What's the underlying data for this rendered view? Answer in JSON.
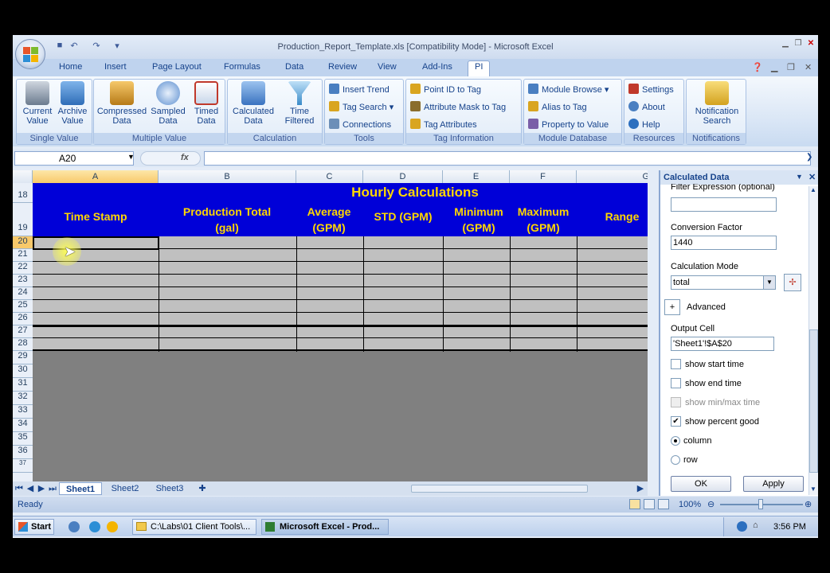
{
  "window": {
    "title": "Production_Report_Template.xls  [Compatibility Mode] - Microsoft Excel"
  },
  "ribbon_tabs": [
    "Home",
    "Insert",
    "Page Layout",
    "Formulas",
    "Data",
    "Review",
    "View",
    "Add-Ins",
    "PI"
  ],
  "active_tab": "PI",
  "groups": {
    "single_value": {
      "label": "Single Value",
      "current": "Current Value",
      "archive": "Archive Value"
    },
    "multiple_value": {
      "label": "Multiple Value",
      "compressed": "Compressed Data",
      "sampled": "Sampled Data",
      "timed": "Timed Data"
    },
    "calculation": {
      "label": "Calculation",
      "calculated": "Calculated Data",
      "time_filtered": "Time Filtered"
    },
    "tools": {
      "label": "Tools",
      "insert_trend": "Insert Trend",
      "tag_search": "Tag Search",
      "connections": "Connections"
    },
    "tag_info": {
      "label": "Tag Information",
      "point_id": "Point ID to Tag",
      "attribute_mask": "Attribute Mask to Tag",
      "tag_attributes": "Tag Attributes"
    },
    "module_db": {
      "label": "Module Database",
      "module_browse": "Module Browse",
      "alias": "Alias to Tag",
      "property": "Property to Value"
    },
    "resources": {
      "label": "Resources",
      "settings": "Settings",
      "about": "About",
      "help": "Help"
    },
    "notifications": {
      "label": "Notifications",
      "search": "Notification Search"
    }
  },
  "formula_bar": {
    "name_box": "A20",
    "fx": "fx"
  },
  "columns": [
    "A",
    "B",
    "C",
    "D",
    "E",
    "F",
    "G"
  ],
  "rows": [
    "18",
    "19",
    "20",
    "21",
    "22",
    "23",
    "24",
    "25",
    "26",
    "27",
    "28",
    "29",
    "30",
    "31",
    "32",
    "33",
    "34",
    "35",
    "36",
    "37"
  ],
  "sheet": {
    "title": "Hourly Calculations",
    "headers": [
      "Time Stamp",
      "Production Total (gal)",
      "Average (GPM)",
      "STD (GPM)",
      "Minimum (GPM)",
      "Maximum (GPM)",
      "Range"
    ]
  },
  "sheet_tabs": [
    "Sheet1",
    "Sheet2",
    "Sheet3"
  ],
  "status": {
    "ready": "Ready",
    "zoom": "100%"
  },
  "pane": {
    "title": "Calculated Data",
    "filter_label": "Filter Expression (optional)",
    "conversion_label": "Conversion Factor",
    "conversion_value": "1440",
    "mode_label": "Calculation Mode",
    "mode_value": "total",
    "advanced": "Advanced",
    "output_label": "Output Cell",
    "output_value": "'Sheet1'!$A$20",
    "show_start": "show start time",
    "show_end": "show end time",
    "show_minmax": "show min/max time",
    "show_percent": "show percent good",
    "column": "column",
    "row": "row",
    "ok": "OK",
    "apply": "Apply"
  },
  "taskbar": {
    "start": "Start",
    "item1": "C:\\Labs\\01 Client Tools\\...",
    "item2": "Microsoft Excel - Prod...",
    "clock": "3:56 PM"
  }
}
